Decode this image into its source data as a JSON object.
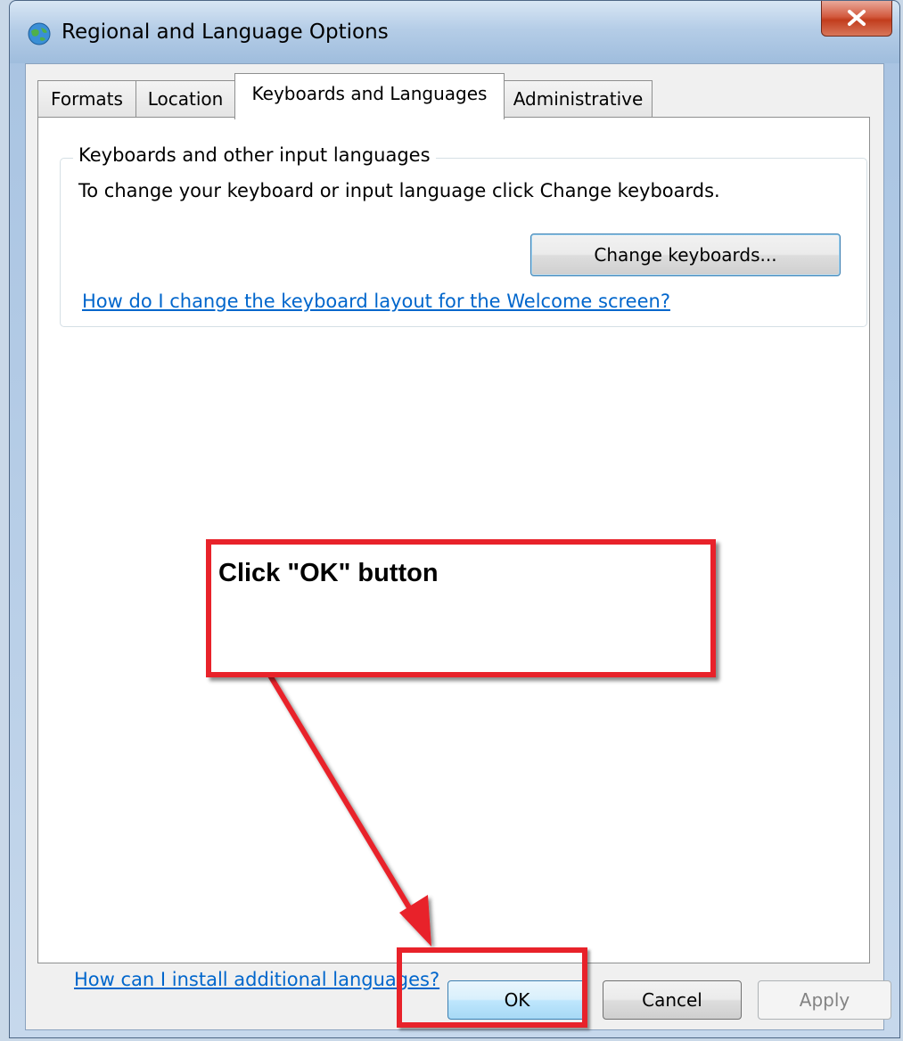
{
  "window": {
    "title": "Regional and Language Options",
    "icon": "globe-icon",
    "close_icon": "close-icon"
  },
  "tabs": [
    {
      "label": "Formats",
      "active": false
    },
    {
      "label": "Location",
      "active": false
    },
    {
      "label": "Keyboards and Languages",
      "active": true
    },
    {
      "label": "Administrative",
      "active": false
    }
  ],
  "keyboards_group": {
    "legend": "Keyboards and other input languages",
    "description": "To change your keyboard or input language click Change keyboards.",
    "change_button": "Change keyboards...",
    "welcome_link": "How do I change the keyboard layout for the Welcome screen?"
  },
  "install_link": "How can I install additional languages?",
  "footer": {
    "ok": "OK",
    "cancel": "Cancel",
    "apply": "Apply",
    "apply_disabled": true
  },
  "annotation": {
    "callout_text": "Click \"OK\" button",
    "accent_color": "#e8222a"
  },
  "colors": {
    "link": "#0066cc",
    "close_button": "#c23d1d",
    "focused_button": "#a7d9f5"
  }
}
